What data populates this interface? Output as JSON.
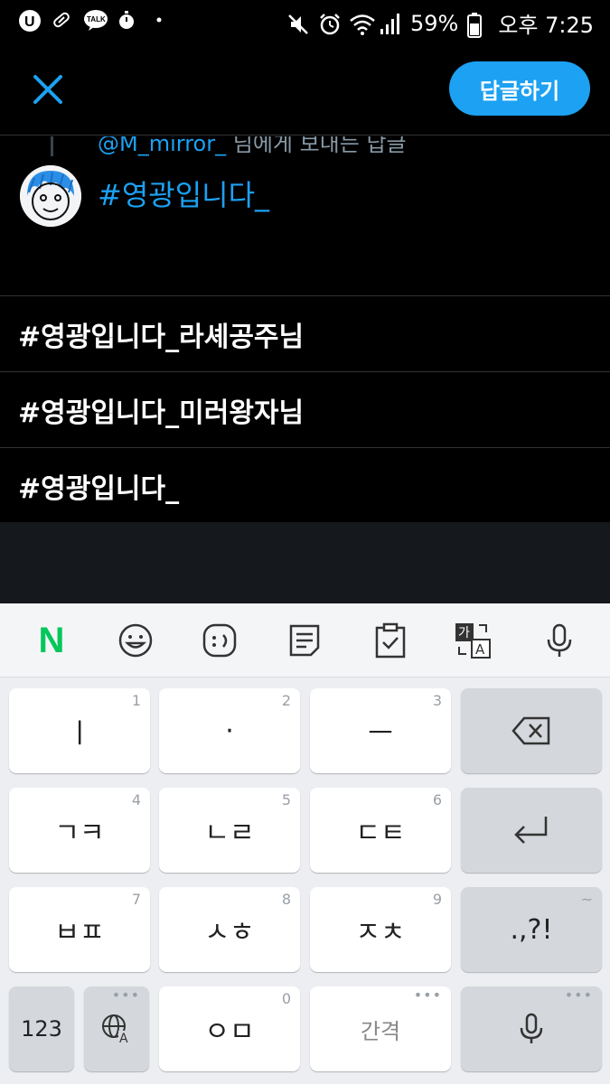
{
  "status_bar": {
    "battery": "59%",
    "time": "오후 7:25",
    "left_icons": [
      "uplus-icon",
      "pill-icon",
      "kakaotalk-icon",
      "stopwatch-icon",
      "dot-icon"
    ],
    "right_icons": [
      "mute-icon",
      "alarm-icon",
      "wifi-icon",
      "signal-icon",
      "battery-icon"
    ],
    "talk_label": "TALK"
  },
  "top_bar": {
    "reply_button": "답글하기"
  },
  "compose": {
    "reply_to_handle": "@M_mirror_",
    "reply_to_suffix": "님에게 보내는 답글",
    "text": "#영광입니다_"
  },
  "suggestions": [
    "#영광입니다_라셰공주님",
    "#영광입니다_미러왕자님",
    "#영광입니다_"
  ],
  "keyboard": {
    "toolbar": [
      "naver-n-icon",
      "emoji-icon",
      "emoticon-icon",
      "memo-icon",
      "clipboard-icon",
      "translate-icon",
      "mic-icon"
    ],
    "naver_label": "N",
    "rows": [
      [
        {
          "label": "ㅣ",
          "hint": "1"
        },
        {
          "label": "·",
          "hint": "2"
        },
        {
          "label": "ㅡ",
          "hint": "3"
        }
      ],
      [
        {
          "label": "ㄱㅋ",
          "hint": "4"
        },
        {
          "label": "ㄴㄹ",
          "hint": "5"
        },
        {
          "label": "ㄷㅌ",
          "hint": "6"
        }
      ],
      [
        {
          "label": "ㅂㅍ",
          "hint": "7"
        },
        {
          "label": "ㅅㅎ",
          "hint": "8"
        },
        {
          "label": "ㅈㅊ",
          "hint": "9"
        }
      ],
      [
        {
          "label": "ㅇㅁ",
          "hint": "0"
        }
      ]
    ],
    "punct_key": ".,?!",
    "punct_hint": "~",
    "num_key": "123",
    "space_key": "간격",
    "more_dots": "•••"
  }
}
